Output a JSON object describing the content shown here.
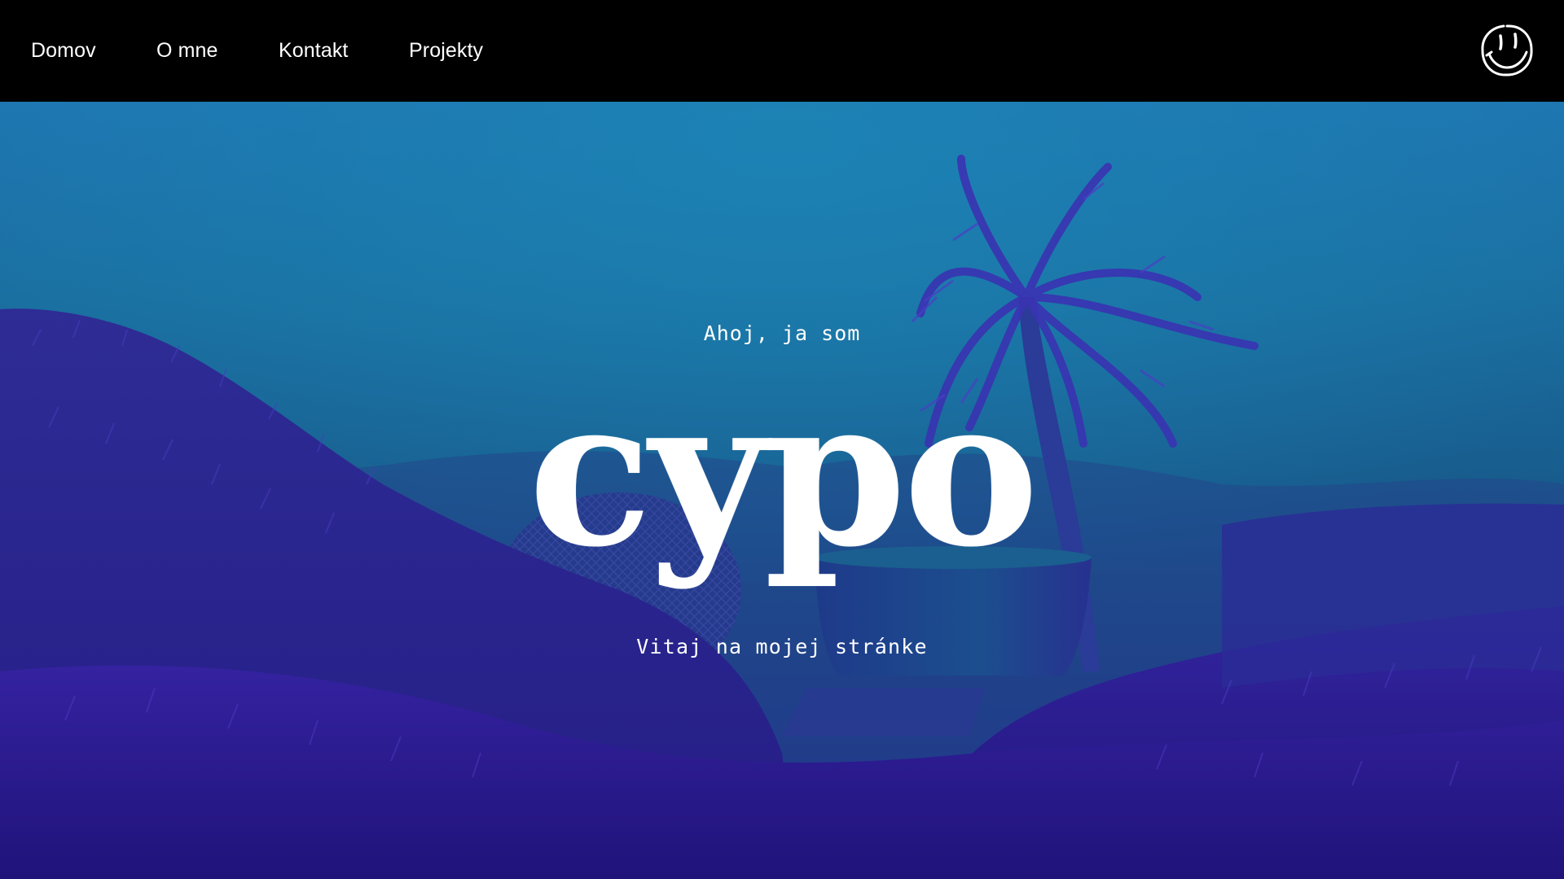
{
  "nav": {
    "links": [
      {
        "label": "Domov"
      },
      {
        "label": "O mne"
      },
      {
        "label": "Kontakt"
      },
      {
        "label": "Projekty"
      }
    ],
    "logo_icon": "smiley-icon"
  },
  "hero": {
    "greeting": "Ahoj, ja som",
    "name": "cypo",
    "welcome": "Vitaj na mojej stránke"
  },
  "colors": {
    "nav_background": "#000000",
    "text": "#ffffff",
    "sky_top": "#1f74b1",
    "grass": "#2c1f8f"
  }
}
